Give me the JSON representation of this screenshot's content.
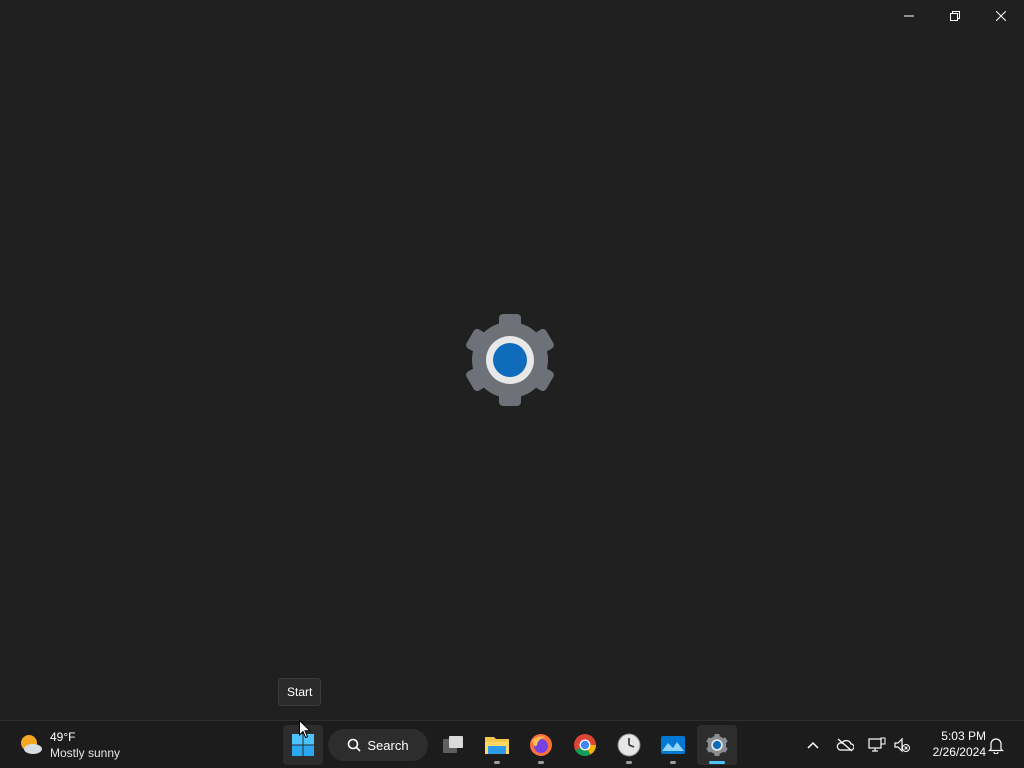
{
  "window": {
    "controls": {
      "minimize_icon": "minimize-icon",
      "restore_icon": "restore-icon",
      "close_icon": "close-icon"
    }
  },
  "splash": {
    "icon": "settings-gear-icon",
    "accent": "#0f6cbd"
  },
  "tooltip": {
    "text": "Start"
  },
  "taskbar": {
    "weather": {
      "temperature": "49°F",
      "condition": "Mostly sunny",
      "icon": "partly-sunny-icon"
    },
    "search": {
      "label": "Search"
    },
    "apps": [
      {
        "name": "Start",
        "icon": "windows-start-icon"
      },
      {
        "name": "Task View",
        "icon": "task-view-icon"
      },
      {
        "name": "File Explorer",
        "icon": "folder-icon"
      },
      {
        "name": "Firefox",
        "icon": "firefox-icon"
      },
      {
        "name": "Chrome",
        "icon": "chrome-icon"
      },
      {
        "name": "Clock",
        "icon": "clock-icon"
      },
      {
        "name": "Photos",
        "icon": "photos-icon"
      },
      {
        "name": "Settings",
        "icon": "gear-icon"
      }
    ],
    "tray": {
      "icons": [
        "chevron-up-icon",
        "onedrive-offline-icon",
        "network-icon",
        "volume-muted-icon",
        "notification-bell-icon"
      ]
    },
    "clock": {
      "time": "5:03 PM",
      "date": "2/26/2024"
    }
  }
}
